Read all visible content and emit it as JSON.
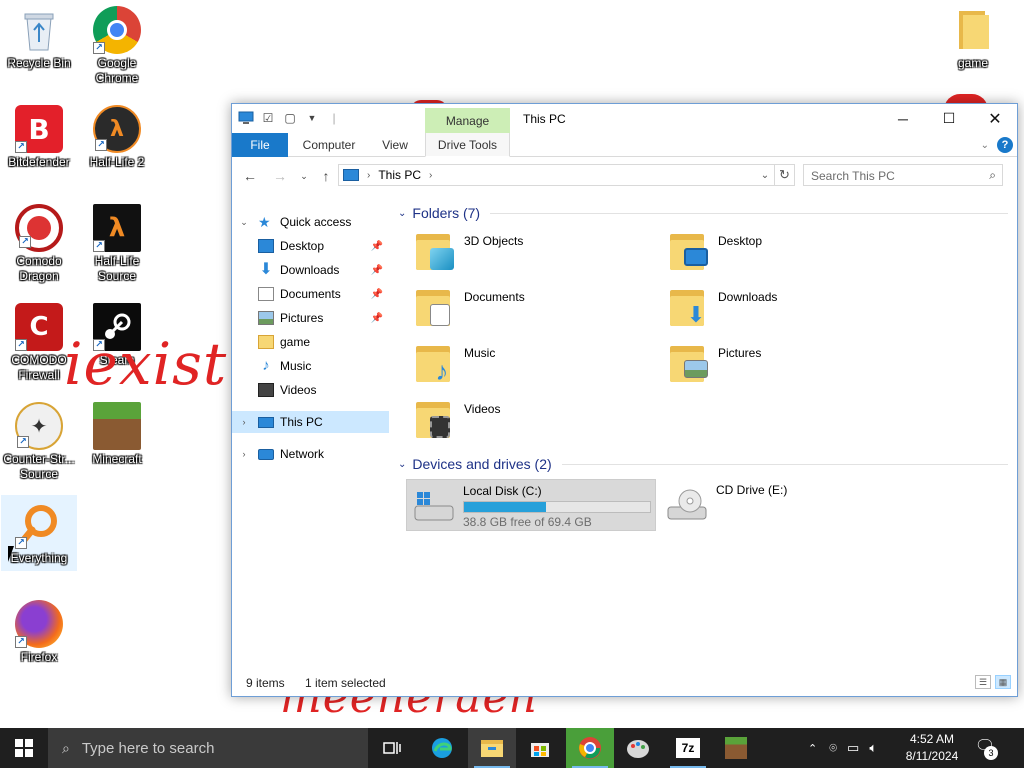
{
  "desktop": {
    "icons": [
      {
        "label": "Recycle Bin"
      },
      {
        "label": "Google Chrome"
      },
      {
        "label": "Bitdefender"
      },
      {
        "label": "Half-Life 2"
      },
      {
        "label": "Comodo Dragon"
      },
      {
        "label": "Half-Life Source"
      },
      {
        "label": "COMODO Firewall"
      },
      {
        "label": "Steam"
      },
      {
        "label": "Counter-Str... Source"
      },
      {
        "label": "Minecraft"
      },
      {
        "label": "Everything"
      },
      {
        "label": "Firefox"
      },
      {
        "label": "game"
      }
    ],
    "watermark_top": "iexist",
    "watermark_bottom": "meeneraeh"
  },
  "window": {
    "title": "This PC",
    "manage_label": "Manage",
    "tabs": {
      "file": "File",
      "computer": "Computer",
      "view": "View",
      "drive_tools": "Drive Tools"
    },
    "address": {
      "path": "This PC"
    },
    "search": {
      "placeholder": "Search This PC"
    },
    "nav": {
      "quick_access": "Quick access",
      "desktop": "Desktop",
      "downloads": "Downloads",
      "documents": "Documents",
      "pictures": "Pictures",
      "game": "game",
      "music": "Music",
      "videos": "Videos",
      "this_pc": "This PC",
      "network": "Network"
    },
    "groups": {
      "folders_header": "Folders (7)",
      "drives_header": "Devices and drives (2)"
    },
    "folders": [
      {
        "name": "3D Objects"
      },
      {
        "name": "Desktop"
      },
      {
        "name": "Documents"
      },
      {
        "name": "Downloads"
      },
      {
        "name": "Music"
      },
      {
        "name": "Pictures"
      },
      {
        "name": "Videos"
      }
    ],
    "drives": [
      {
        "name": "Local Disk (C:)",
        "free_text": "38.8 GB free of 69.4 GB",
        "used_fraction": 0.44
      },
      {
        "name": "CD Drive (E:)"
      }
    ],
    "status": {
      "items": "9 items",
      "selected": "1 item selected"
    }
  },
  "taskbar": {
    "search_placeholder": "Type here to search",
    "time": "4:52 AM",
    "date": "8/11/2024",
    "notification_count": "3"
  },
  "colors": {
    "accent": "#1979ca",
    "selection": "#cce8ff",
    "manage_tab": "#cdeeb6",
    "group_header": "#1e3287",
    "watermark": "#e02424",
    "disk_bar": "#26a0da"
  }
}
